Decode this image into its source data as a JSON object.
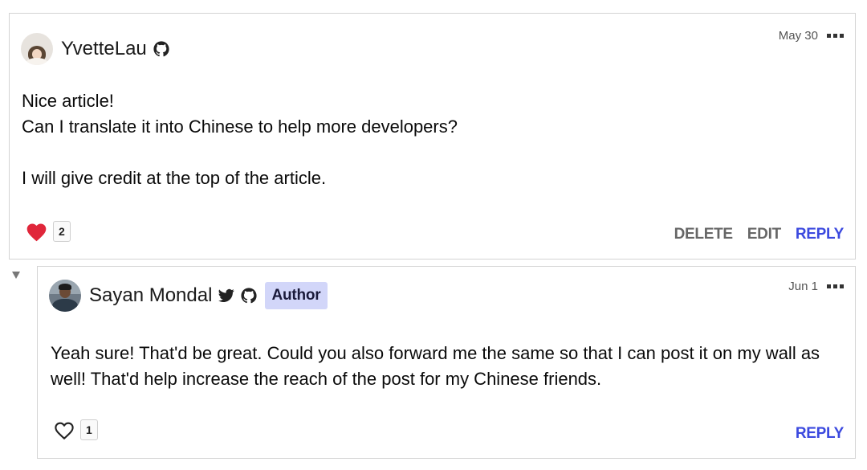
{
  "comments": [
    {
      "author": "YvetteLau",
      "date": "May 30",
      "body": "Nice article!\nCan I translate it into Chinese to help more developers?\n\nI will give credit at the top of the article.",
      "reaction_count": "2",
      "reaction_state": "liked",
      "actions": {
        "delete": "DELETE",
        "edit": "EDIT",
        "reply": "REPLY"
      },
      "icons": [
        "github-icon"
      ]
    },
    {
      "author": "Sayan Mondal",
      "badge": "Author",
      "date": "Jun 1",
      "body": "Yeah sure! That'd be great. Could you also forward me the same so that I can post it on my wall as well! That'd help increase the reach of the post for my Chinese friends.",
      "reaction_count": "1",
      "reaction_state": "not-liked",
      "actions": {
        "reply": "REPLY"
      },
      "icons": [
        "twitter-icon",
        "github-icon"
      ]
    }
  ],
  "colors": {
    "accent": "#3b49df",
    "badge_bg": "#d2d6f9",
    "heart_red": "#e0263a",
    "action_gray": "#666666",
    "border": "#d4d4d4"
  }
}
